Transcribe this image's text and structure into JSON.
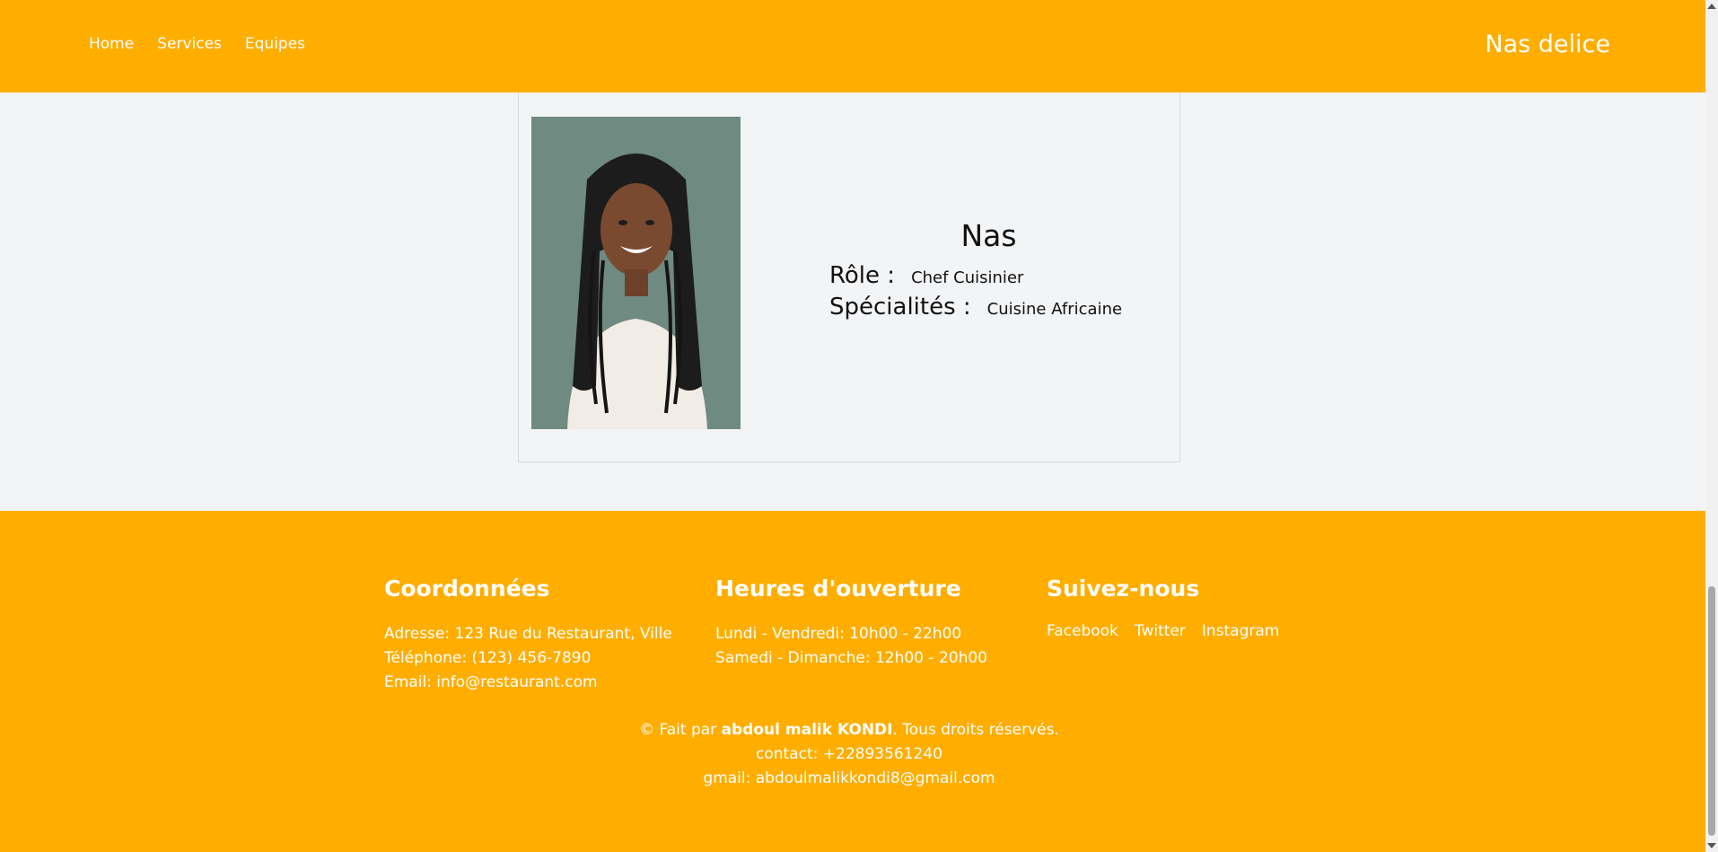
{
  "nav": {
    "links": [
      "Home",
      "Services",
      "Equipes"
    ],
    "brand": "Nas delice"
  },
  "member": {
    "name": "Nas",
    "role_label": "Rôle :",
    "role_value": "Chef Cuisinier",
    "specialty_label": "Spécialités :",
    "specialty_value": "Cuisine Africaine"
  },
  "footer": {
    "contact": {
      "title": "Coordonnées",
      "address": "Adresse: 123 Rue du Restaurant, Ville",
      "phone": "Téléphone: (123) 456-7890",
      "email": "Email: info@restaurant.com"
    },
    "hours": {
      "title": "Heures d'ouverture",
      "weekdays": "Lundi - Vendredi: 10h00 - 22h00",
      "weekend": "Samedi - Dimanche: 12h00 - 20h00"
    },
    "social": {
      "title": "Suivez-nous",
      "links": [
        "Facebook",
        "Twitter",
        "Instagram"
      ]
    },
    "credits": {
      "prefix": "© Fait par ",
      "author": "abdoul malik KONDI",
      "suffix": ". Tous droits réservés.",
      "contact": "contact: +22893561240",
      "gmail": "gmail: abdoulmalikkondi8@gmail.com"
    }
  },
  "colors": {
    "accent": "#ffae00",
    "background": "#f3f4f6"
  }
}
